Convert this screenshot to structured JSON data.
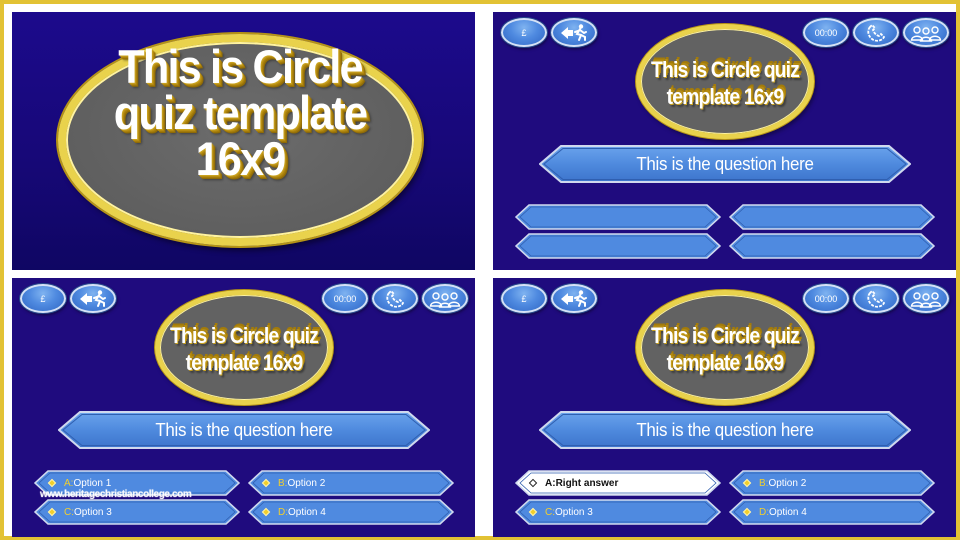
{
  "colors": {
    "frame_gold": "#e2c234",
    "slide_blue": "#1f0b7e",
    "oval_gold": "#e9d24c",
    "oval_gray": "#626262",
    "button_blue": "#4f8ae0",
    "answer_letter_gold": "#f2cf2d",
    "selected_answer_bg": "#ffffff"
  },
  "title_slide": {
    "title": "This is Circle\nquiz template\n16x9"
  },
  "game": {
    "title": "This is Circle quiz\ntemplate 16x9",
    "lifelines": {
      "money_label": "£",
      "money_icon": "pound-icon",
      "walk_away_icon": "exit-running-man-icon",
      "timer_label": "00:00",
      "phone_icon": "phone-a-friend-icon",
      "audience_icon": "ask-the-audience-icon"
    },
    "question": "This is the question here"
  },
  "slides": [
    {
      "id": "slide-1",
      "type": "title"
    },
    {
      "id": "slide-2",
      "type": "blank-answers",
      "answers": [
        {
          "letter": "",
          "text": ""
        },
        {
          "letter": "",
          "text": ""
        },
        {
          "letter": "",
          "text": ""
        },
        {
          "letter": "",
          "text": ""
        }
      ]
    },
    {
      "id": "slide-3",
      "type": "options",
      "answers": [
        {
          "letter": "A:",
          "text": " Option 1"
        },
        {
          "letter": "B:",
          "text": " Option 2"
        },
        {
          "letter": "C:",
          "text": " Option 3"
        },
        {
          "letter": "D:",
          "text": " Option 4"
        }
      ]
    },
    {
      "id": "slide-4",
      "type": "answer-selected",
      "selected_index": 0,
      "answers": [
        {
          "letter": "A:",
          "text": " Right answer"
        },
        {
          "letter": "B:",
          "text": " Option 2"
        },
        {
          "letter": "C:",
          "text": " Option 3"
        },
        {
          "letter": "D:",
          "text": " Option 4"
        }
      ]
    }
  ],
  "watermark": "www.heritagechristiancollege.com"
}
